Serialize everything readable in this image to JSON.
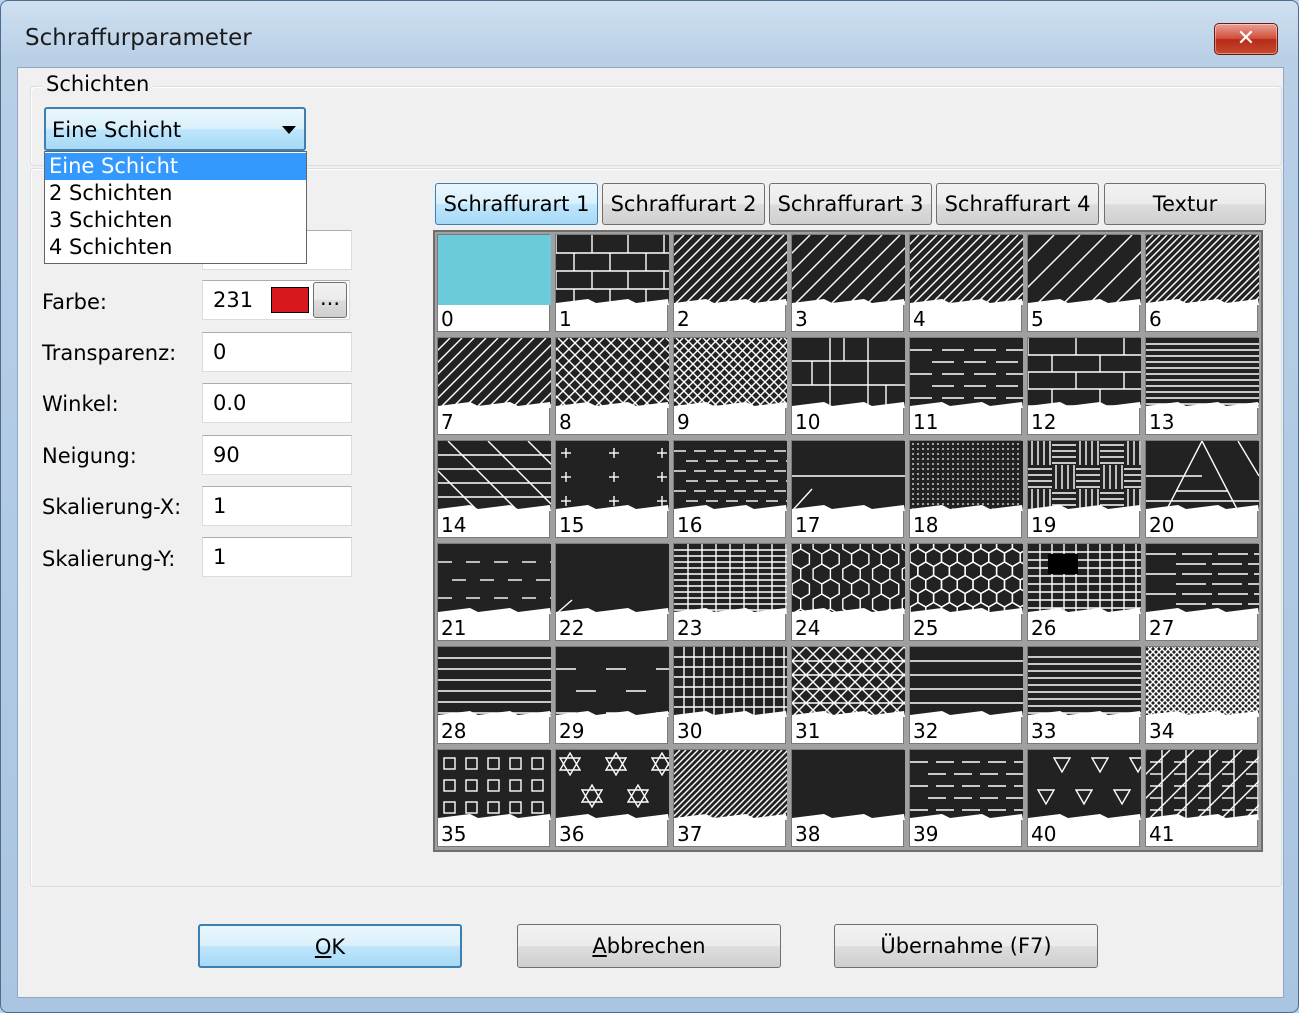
{
  "window": {
    "title": "Schraffurparameter",
    "close_glyph": "✕"
  },
  "layers": {
    "group_label": "Schichten",
    "selected": "Eine Schicht",
    "options": [
      "Eine Schicht",
      "2 Schichten",
      "3 Schichten",
      "4 Schichten"
    ]
  },
  "params": {
    "color": {
      "label": "Farbe:",
      "value": "231",
      "swatch": "#d7191e",
      "more": "..."
    },
    "transparency": {
      "label": "Transparenz:",
      "value": "0"
    },
    "angle": {
      "label": "Winkel:",
      "value": "0.0"
    },
    "slope": {
      "label": "Neigung:",
      "value": "90"
    },
    "scale_x": {
      "label": "Skalierung-X:",
      "value": "1"
    },
    "scale_y": {
      "label": "Skalierung-Y:",
      "value": "1"
    }
  },
  "tabs": [
    "Schraffurart 1",
    "Schraffurart 2",
    "Schraffurart 3",
    "Schraffurart 4",
    "Textur"
  ],
  "active_tab": 0,
  "patterns": [
    "0",
    "1",
    "2",
    "3",
    "4",
    "5",
    "6",
    "7",
    "8",
    "9",
    "10",
    "11",
    "12",
    "13",
    "14",
    "15",
    "16",
    "17",
    "18",
    "19",
    "20",
    "21",
    "22",
    "23",
    "24",
    "25",
    "26",
    "27",
    "28",
    "29",
    "30",
    "31",
    "32",
    "33",
    "34",
    "35",
    "36",
    "37",
    "38",
    "39",
    "40",
    "41"
  ],
  "selected_pattern_color": "#6ccbdb",
  "buttons": {
    "ok": {
      "accel": "O",
      "rest": "K"
    },
    "cancel": {
      "accel": "A",
      "rest": "bbrechen"
    },
    "apply": "Übernahme (F7)"
  }
}
